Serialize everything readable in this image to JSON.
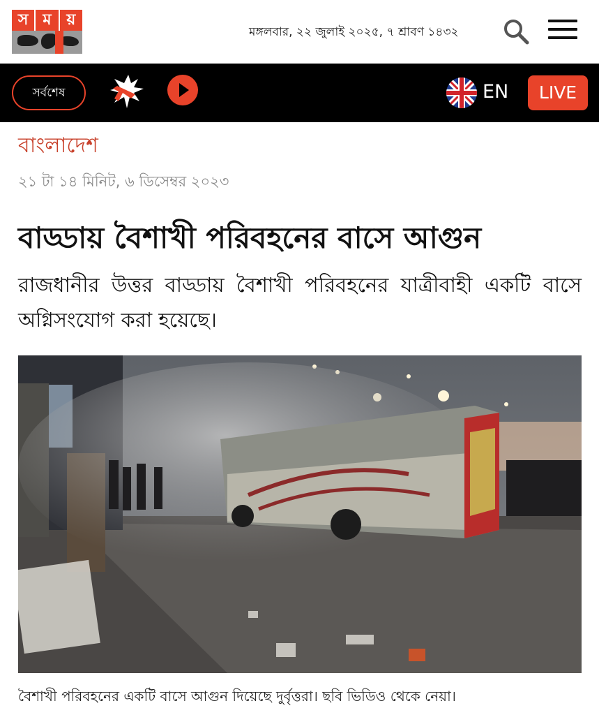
{
  "header": {
    "logo_letters": [
      "স",
      "ম",
      "য়"
    ],
    "date_line": "মঙ্গলবার, ২২ জুলাই ২০২৫, ৭ শ্রাবণ ১৪৩২",
    "search_icon": "search-icon",
    "menu_icon": "hamburger-menu-icon"
  },
  "nav": {
    "latest_label": "সর্বশেষ",
    "breaking_icon": "breaking-news-icon",
    "play_icon": "play-icon",
    "flag_icon": "uk-flag-icon",
    "language_label": "EN",
    "live_label": "LIVE"
  },
  "article": {
    "category": "বাংলাদেশ",
    "timestamp": "২১ টা ১৪ মিনিট, ৬ ডিসেম্বর ২০২৩",
    "headline": "বাড্ডায় বৈশাখী পরিবহনের বাসে আগুন",
    "summary": "রাজধানীর উত্তর বাড্ডায় বৈশাখী পরিবহনের যাত্রীবাহী একটি বাসে অগ্নিসংযোগ করা হয়েছে।",
    "photo_caption": "বৈশাখী পরিবহনের একটি বাসে আগুন দিয়েছে দুর্বৃত্তরা। ছবি ভিডিও থেকে নেয়া।"
  },
  "colors": {
    "brand_red": "#e8432a",
    "nav_bg": "#000000",
    "category_red": "#c8412b",
    "timestamp_gray": "#8a8a8a"
  }
}
